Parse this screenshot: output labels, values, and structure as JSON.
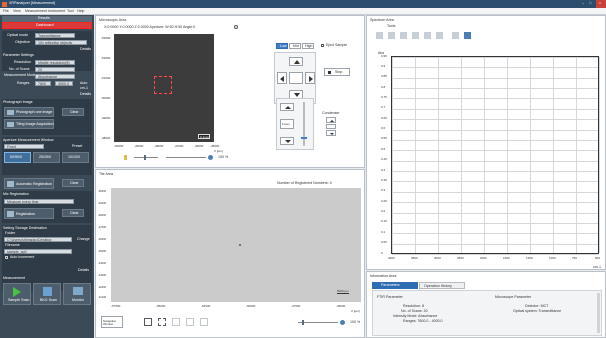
{
  "app": {
    "title": "XRPanalyzer [Measurement]",
    "menu": [
      "File",
      "View",
      "Measurement",
      "Instrument",
      "Tool",
      "Help"
    ],
    "window_buttons": [
      "–",
      "□",
      "×"
    ]
  },
  "left_panel": {
    "tabs": {
      "results": "Results",
      "dashboard": "Dashboard"
    },
    "optical_mode_label": "Optical mode",
    "optical_mode_value": "Transmittance",
    "objective_label": "Objective",
    "objective_value": "10x reflective objectiv",
    "detail_button": "Details",
    "param_header": "Parameter Settings",
    "resolution_label": "Resolution",
    "resolution_value": "Middle resolution(8)",
    "scans_label": "No. of Scans",
    "scans_value": "20",
    "mode_label": "Measurement Mode",
    "mode_value": "Absorbance",
    "ranges_label": "Ranges",
    "ranges_from": "7800",
    "ranges_to": "4000.0",
    "auto_label": "Auto",
    "ranges_unit": "cm-1",
    "details2": "Details",
    "photo_header": "Photograph Image",
    "photo_button": "Photograph one image",
    "tiling_button": "Tiling Image Acquisition",
    "clear": "Clear",
    "aperture_header": "Aperture Measurement Window",
    "aperture_value": "Fixed",
    "preset_label": "Preset",
    "size_options": [
      "50/50/0",
      "25/25/0",
      "10/10/0"
    ],
    "auto_reg": "Automatic Registration",
    "micro_header": "Mic Registration",
    "micro_value": "Measure every time",
    "registration": "Registration",
    "storage_header": "Setting Storage Destination",
    "folder_label": "Folder",
    "folder_value": "C:\\Users\\shimadzu\\Desktop",
    "change": "Change",
    "filename_label": "Filename",
    "filename_value": "sample_ap0",
    "auto_inc": "Auto Increment",
    "details3": "Details",
    "measure_header": "Measurement",
    "sample_scan": "Sample Scan",
    "bkg_scan": "BKG Scan",
    "monitor": "Monitor"
  },
  "microscopic": {
    "title": "Microscopic Area",
    "coords": "X:0.0000   Y:0.0000   Z:0.0000   Aperture: W:50   H:50   Angle:0",
    "mag_buttons": [
      "Low",
      "Mid",
      "High"
    ],
    "eject": "Eject Sample",
    "stop": "Stop",
    "y_ticks": [
      "-53000",
      "-52000",
      "-51000",
      "-50000",
      "-49000",
      "-48000"
    ],
    "x_ticks": [
      "-50000",
      "-49000",
      "-48000",
      "-47000",
      "-46000",
      "-45000"
    ],
    "x_unit": "X [µm]",
    "scale": "0.1mm",
    "zoom_pct": "100 %",
    "condenser": "Condenser",
    "focus": "Focus"
  },
  "tile": {
    "title": "Tile Area",
    "registered": "Number of Registered Numbers: 0",
    "x_ticks": [
      "-57500",
      "-55000",
      "-52500",
      "-50000",
      "-47500",
      "-45000"
    ],
    "y_ticks": [
      "-50000",
      "-49000",
      "-48000",
      "-47000",
      "-46000",
      "-45000",
      "-44000",
      "-43000",
      "-42000",
      "-41000"
    ],
    "x_unit": "X [µm]",
    "scale": "5000 µm",
    "zoom_pct": "100 %",
    "nav_window": "Navigation Window"
  },
  "spectrum": {
    "title": "Spectrum Area",
    "tool_label": "Tools",
    "ylabel": "Abs",
    "xlabel": "cm-1",
    "y_ticks": [
      "0.95",
      "0.9",
      "0.85",
      "0.8",
      "0.75",
      "0.7",
      "0.65",
      "0.6",
      "0.55",
      "0.5",
      "0.45",
      "0.4",
      "0.35",
      "0.3",
      "0.25",
      "0.2",
      "0.15",
      "0.1",
      "0.05",
      "0"
    ],
    "x_ticks": [
      "4000",
      "3800",
      "3000",
      "2500",
      "2000",
      "1500",
      "1250",
      "1000",
      "750",
      "500"
    ]
  },
  "info": {
    "title": "Information Area",
    "tabs": [
      "Parameters",
      "Operation History"
    ],
    "ftir_header": "FTIR Parameter",
    "micro_header": "Microscope Parameter",
    "rows_left": [
      "Resolution: 8",
      "No. of Scans: 20",
      "Intensity Mode: Absorbance",
      "Ranges: 7800.0 - 4000.0"
    ],
    "rows_right": [
      "Detector: MCT",
      "Optical system: Transmittance"
    ]
  }
}
